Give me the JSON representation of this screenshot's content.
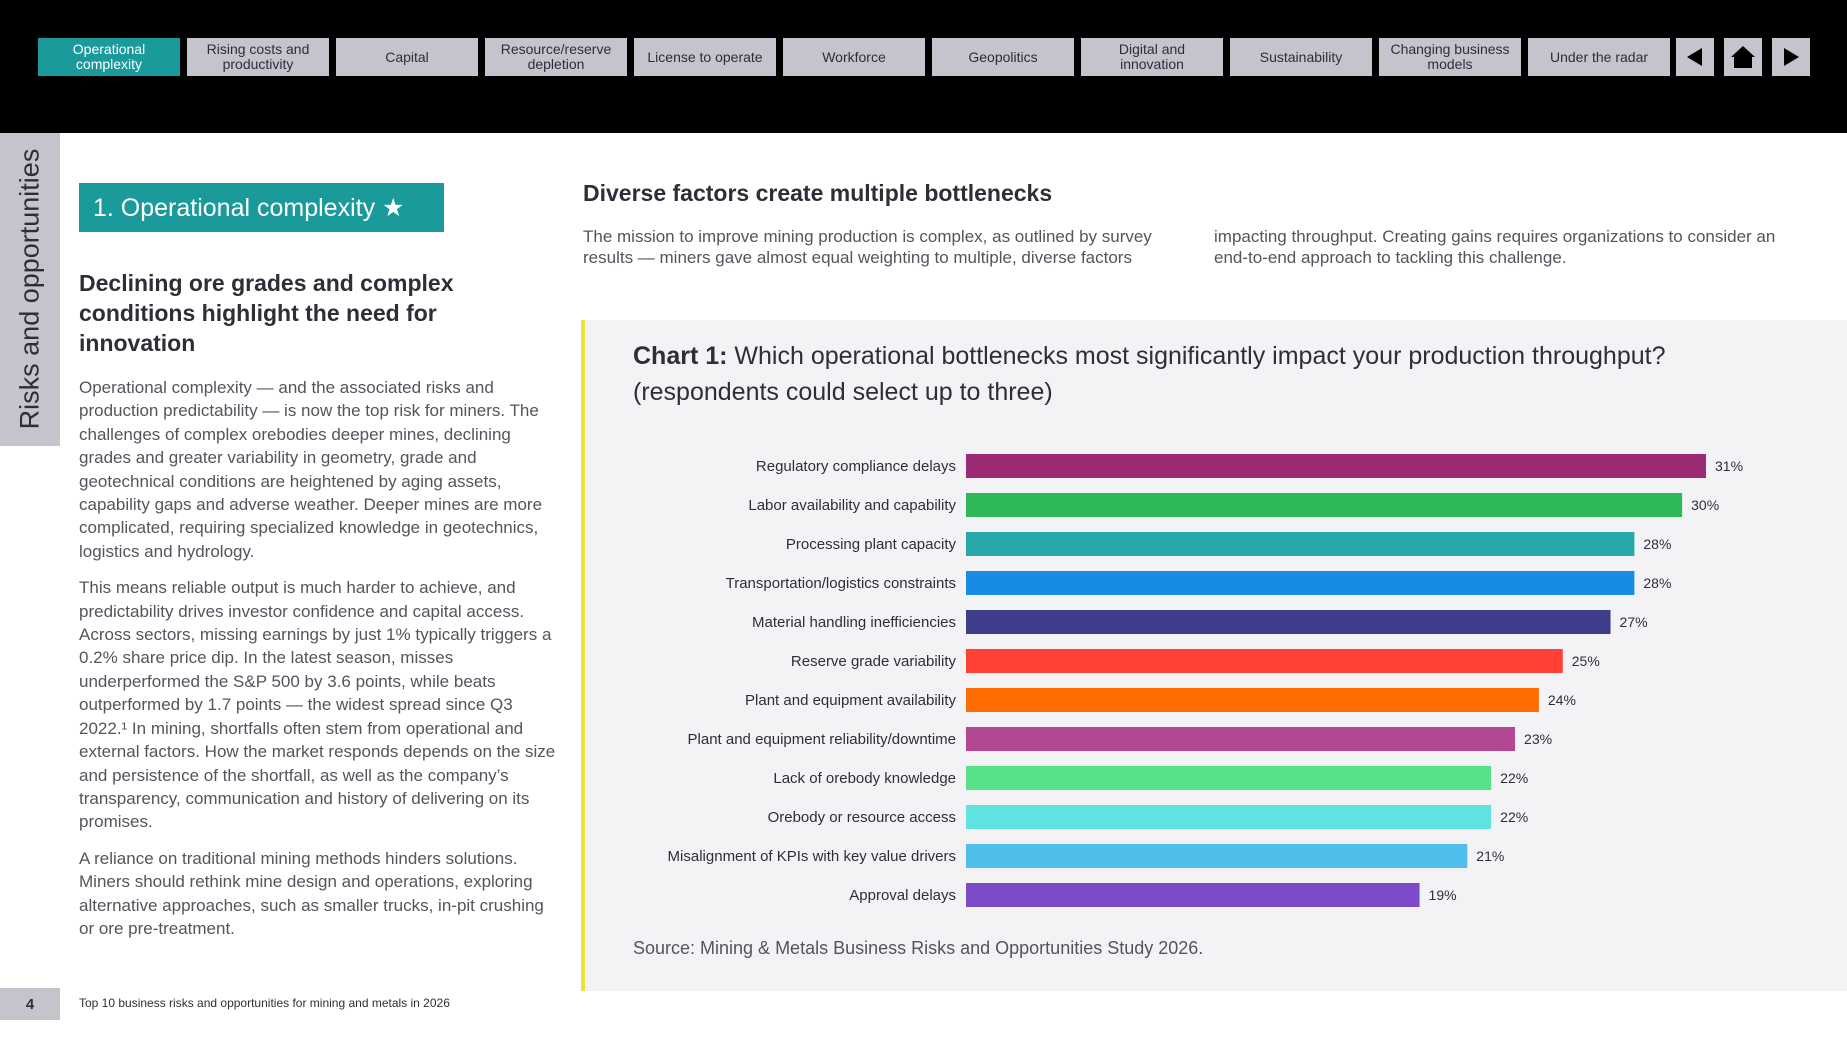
{
  "nav": {
    "tabs": [
      {
        "label": "Operational complexity",
        "active": true
      },
      {
        "label": "Rising costs and productivity"
      },
      {
        "label": "Capital"
      },
      {
        "label": "Resource/reserve depletion"
      },
      {
        "label": "License to operate"
      },
      {
        "label": "Workforce"
      },
      {
        "label": "Geopolitics"
      },
      {
        "label": "Digital and innovation"
      },
      {
        "label": "Sustainability"
      },
      {
        "label": "Changing business models"
      },
      {
        "label": "Under the radar"
      }
    ],
    "buttons": [
      "previous-icon",
      "home-icon",
      "next-icon"
    ]
  },
  "sidebar": {
    "label": "Risks and opportunities"
  },
  "section": {
    "title": "1. Operational complexity ★"
  },
  "left": {
    "subhead": "Declining ore grades and complex conditions highlight the need for innovation",
    "paragraphs": [
      "Operational complexity — and the associated risks and production predictability — is now the top risk for miners. The challenges of complex orebodies deeper mines, declining grades and greater variability in geometry, grade and geotechnical conditions are heightened by aging assets, capability gaps and adverse weather. Deeper mines are more complicated, requiring specialized knowledge in geotechnics, logistics and hydrology.",
      "This means reliable output is much harder to achieve, and predictability drives investor confidence and capital access. Across sectors, missing earnings by just 1% typically triggers a 0.2% share price dip. In the latest season, misses underperformed the S&P 500 by 3.6 points, while beats outperformed by 1.7 points — the widest spread since Q3 2022.¹ In mining, shortfalls often stem from operational and external factors. How the market responds depends on the size and persistence of the shortfall, as well as the company’s transparency, communication and history of delivering on its promises.",
      "A reliance on traditional mining methods hinders solutions. Miners should rethink mine design and operations, exploring alternative approaches, such as smaller trucks, in-pit crushing or ore pre-treatment."
    ]
  },
  "right": {
    "heading": "Diverse factors create multiple bottlenecks",
    "col1": "The mission to improve mining production is complex, as outlined by survey results — miners gave almost equal weighting to multiple, diverse factors",
    "col2": "impacting throughput. Creating gains requires organizations to consider an end-to-end approach to tackling this challenge."
  },
  "chart_data": {
    "type": "bar",
    "orientation": "horizontal",
    "title_prefix": "Chart 1:",
    "title": "Which operational bottlenecks most significantly impact your production throughput? (respondents could select up to three)",
    "categories": [
      "Regulatory compliance delays",
      "Labor availability and capability",
      "Processing plant capacity",
      "Transportation/logistics constraints",
      "Material handling inefficiencies",
      "Reserve grade variability",
      "Plant and equipment availability",
      "Plant and equipment reliability/downtime",
      "Lack of orebody knowledge",
      "Orebody or resource access",
      "Misalignment of KPIs with key value drivers",
      "Approval delays"
    ],
    "values": [
      31,
      30,
      28,
      28,
      27,
      25,
      24,
      23,
      22,
      22,
      21,
      19
    ],
    "labels": [
      "31%",
      "30%",
      "28%",
      "28%",
      "27%",
      "25%",
      "24%",
      "23%",
      "22%",
      "22%",
      "21%",
      "19%"
    ],
    "colors": [
      "#9a2a74",
      "#2db757",
      "#26a8a8",
      "#188ce5",
      "#3d3d8c",
      "#ff4136",
      "#ff6d00",
      "#b14891",
      "#57e188",
      "#5ee3e0",
      "#4ebeeb",
      "#7c4bc8"
    ],
    "xlim": [
      0,
      31
    ],
    "grid": false,
    "source": "Source: Mining & Metals Business Risks and Opportunities Study 2026."
  },
  "footer": {
    "page": "4",
    "text": "Top 10 business risks and opportunities for mining and metals in 2026"
  }
}
